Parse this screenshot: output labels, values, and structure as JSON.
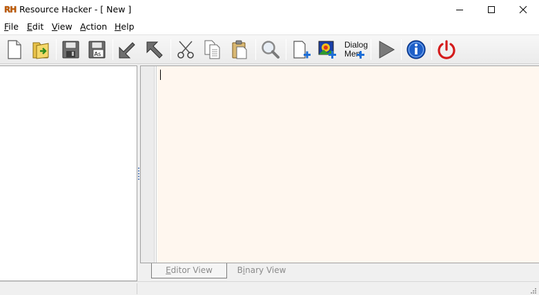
{
  "window": {
    "app_icon_text": "RH",
    "title": "Resource Hacker - [ New ]"
  },
  "menu": {
    "items": [
      {
        "id": "file",
        "first": "F",
        "rest": "ile"
      },
      {
        "id": "edit",
        "first": "E",
        "rest": "dit"
      },
      {
        "id": "view",
        "first": "V",
        "rest": "iew"
      },
      {
        "id": "action",
        "first": "A",
        "rest": "ction"
      },
      {
        "id": "help",
        "first": "H",
        "rest": "elp"
      }
    ]
  },
  "toolbar": {
    "buttons": [
      "new-file-icon",
      "open-file-icon",
      "save-icon",
      "save-as-icon",
      "compile-arrow-icon",
      "export-arrow-icon",
      "cut-icon",
      "copy-icon",
      "paste-icon",
      "find-icon",
      "add-resource-icon",
      "add-image-resource-icon",
      "add-dialog-menu-icon",
      "run-script-icon",
      "about-icon",
      "exit-icon"
    ],
    "save_as_label": "As",
    "dialog_label_line1": "Dialog",
    "dialog_label_line2": "Men"
  },
  "editor": {
    "content": ""
  },
  "tabs": {
    "editor_first": "E",
    "editor_rest": "ditor View",
    "binary_first": "B",
    "binary_mid": "i",
    "binary_rest": "nary View"
  },
  "colors": {
    "editor_background": "#fff7ef",
    "accent_blue": "#1e6fd6",
    "exit_red": "#d41b1b",
    "icon_gray": "#6e6e6e"
  }
}
